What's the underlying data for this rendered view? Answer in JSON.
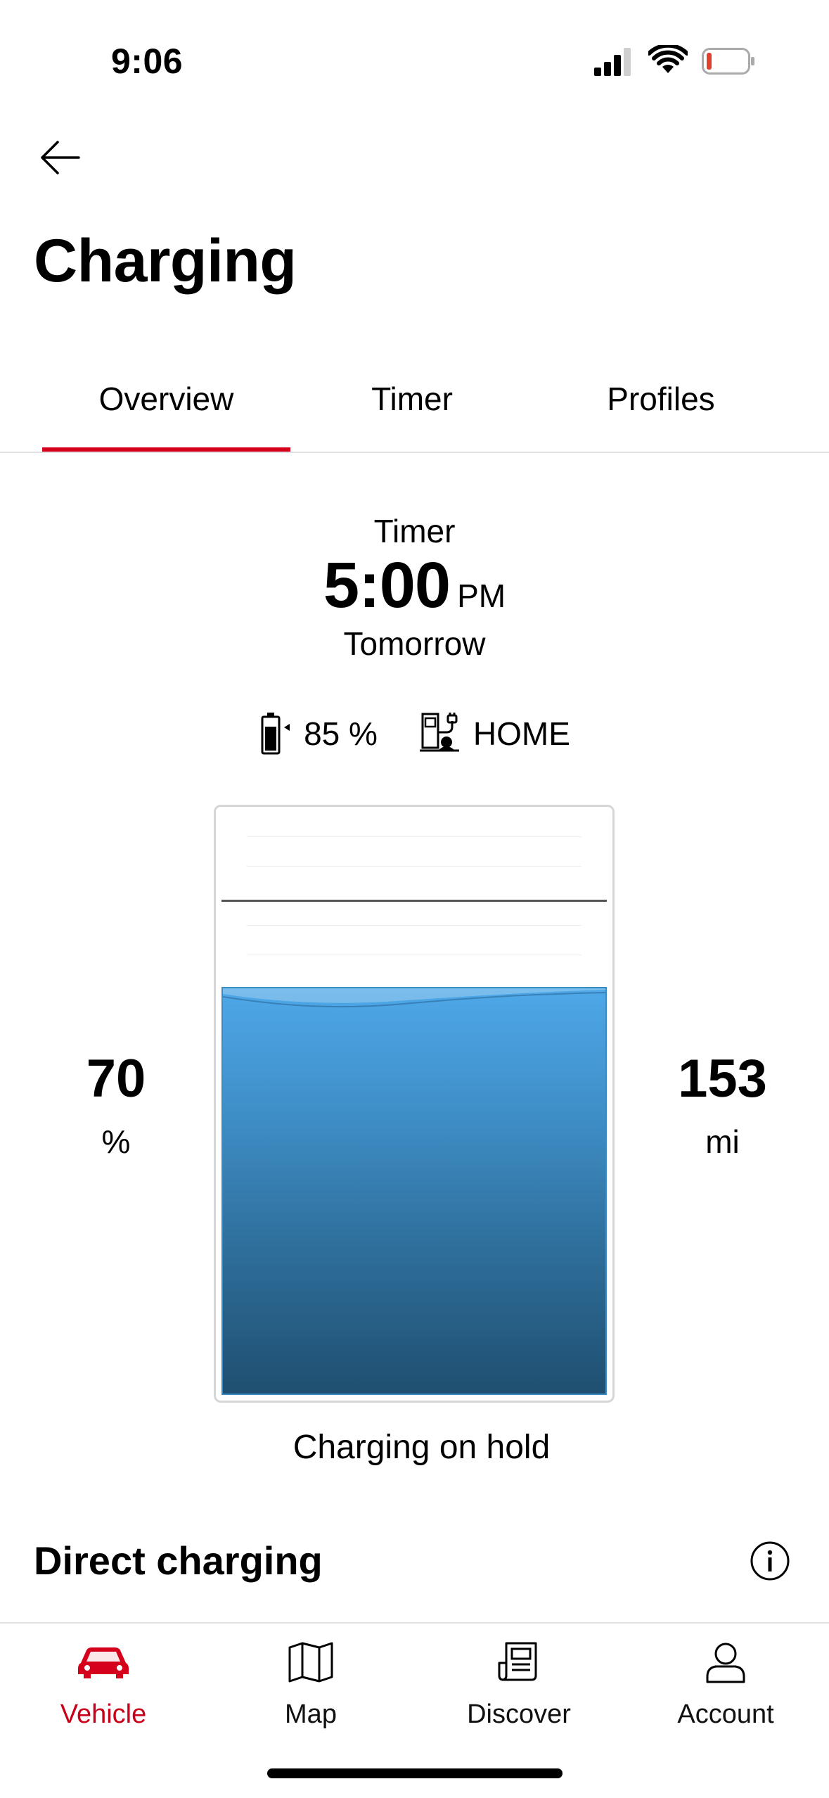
{
  "status_bar": {
    "time": "9:06"
  },
  "header": {
    "title": "Charging",
    "back_icon": "arrow-left-icon"
  },
  "tabs": [
    {
      "label": "Overview",
      "active": true
    },
    {
      "label": "Timer",
      "active": false
    },
    {
      "label": "Profiles",
      "active": false
    }
  ],
  "timer": {
    "label": "Timer",
    "time": "5:00",
    "ampm": "PM",
    "day": "Tomorrow"
  },
  "info": {
    "target_charge": "85 %",
    "location": "HOME"
  },
  "gauge": {
    "state_of_charge": "70",
    "soc_unit": "%",
    "range": "153",
    "range_unit": "mi",
    "fill_fraction": 0.7,
    "target_fraction": 0.85
  },
  "charge_status": "Charging on hold",
  "direct_charging": {
    "title": "Direct charging"
  },
  "nav": [
    {
      "label": "Vehicle",
      "icon": "car-icon",
      "active": true
    },
    {
      "label": "Map",
      "icon": "map-icon",
      "active": false
    },
    {
      "label": "Discover",
      "icon": "newspaper-icon",
      "active": false
    },
    {
      "label": "Account",
      "icon": "user-icon",
      "active": false
    }
  ],
  "colors": {
    "accent": "#d5001c",
    "fill_top": "#4ea8e8",
    "fill_bottom": "#1f4f70"
  }
}
